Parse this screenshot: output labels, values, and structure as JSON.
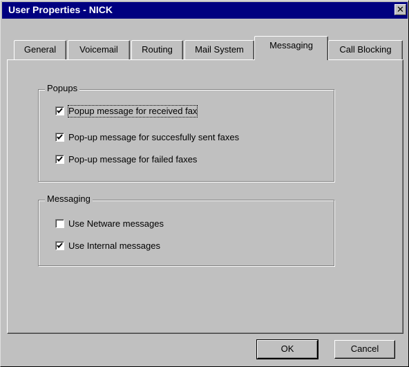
{
  "window": {
    "title": "User Properties - NICK",
    "close_glyph": "✕"
  },
  "tabs": [
    {
      "label": "General"
    },
    {
      "label": "Voicemail"
    },
    {
      "label": "Routing"
    },
    {
      "label": "Mail System"
    },
    {
      "label": "Messaging",
      "active": true
    },
    {
      "label": "Call Blocking"
    }
  ],
  "popups": {
    "label": "Popups",
    "items": [
      {
        "label": "Popup message for received fax",
        "checked": true
      },
      {
        "label": "Pop-up message for succesfully sent faxes",
        "checked": true
      },
      {
        "label": "Pop-up message for failed faxes",
        "checked": true
      }
    ]
  },
  "messaging": {
    "label": "Messaging",
    "items": [
      {
        "label": "Use Netware messages",
        "checked": false
      },
      {
        "label": "Use Internal messages",
        "checked": true
      }
    ]
  },
  "buttons": {
    "ok": "OK",
    "cancel": "Cancel"
  }
}
